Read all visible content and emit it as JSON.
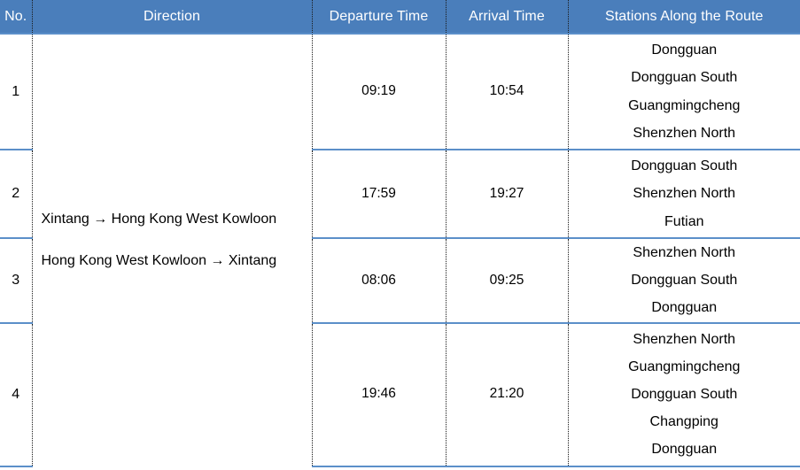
{
  "table": {
    "columns": [
      {
        "key": "no",
        "label": "No."
      },
      {
        "key": "direction",
        "label": "Direction"
      },
      {
        "key": "departure",
        "label": "Departure Time"
      },
      {
        "key": "arrival",
        "label": "Arrival Time"
      },
      {
        "key": "stations",
        "label": "Stations Along the Route"
      }
    ],
    "directions": [
      {
        "label": "Xintang → Hong Kong West Kowloon"
      },
      {
        "label": "Hong Kong West Kowloon → Xintang"
      }
    ],
    "rows": [
      {
        "no": "1",
        "departure": "09:19",
        "arrival": "10:54",
        "stations": [
          "Dongguan",
          "Dongguan South",
          "Guangmingcheng",
          "Shenzhen North"
        ]
      },
      {
        "no": "2",
        "departure": "17:59",
        "arrival": "19:27",
        "stations": [
          "Dongguan South",
          "Shenzhen North",
          "Futian"
        ]
      },
      {
        "no": "3",
        "departure": "08:06",
        "arrival": "09:25",
        "stations": [
          "Shenzhen North",
          "Dongguan South",
          "Dongguan"
        ]
      },
      {
        "no": "4",
        "departure": "19:46",
        "arrival": "21:20",
        "stations": [
          "Shenzhen North",
          "Guangmingcheng",
          "Dongguan South",
          "Changping",
          "Dongguan"
        ]
      }
    ]
  },
  "colors": {
    "header_background": "#4a7ebb",
    "header_text": "#ffffff",
    "rule": "#5b8fc9",
    "divider": "#1a1a1a",
    "body_background": "#ffffff",
    "body_text": "#000000"
  }
}
